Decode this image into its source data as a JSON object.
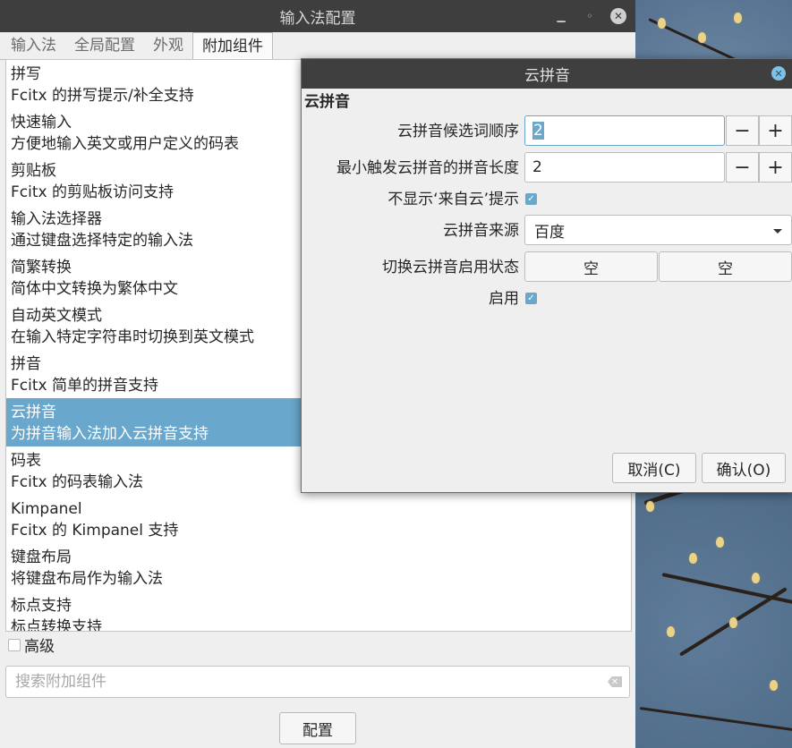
{
  "main_window": {
    "title": "输入法配置",
    "tabs": [
      {
        "label": "输入法"
      },
      {
        "label": "全局配置"
      },
      {
        "label": "外观"
      },
      {
        "label": "附加组件"
      }
    ],
    "addons": [
      {
        "name": "拼写",
        "desc": "Fcitx 的拼写提示/补全支持"
      },
      {
        "name": "快速输入",
        "desc": "方便地输入英文或用户定义的码表"
      },
      {
        "name": "剪贴板",
        "desc": "Fcitx 的剪贴板访问支持"
      },
      {
        "name": "输入法选择器",
        "desc": "通过键盘选择特定的输入法"
      },
      {
        "name": "简繁转换",
        "desc": "简体中文转换为繁体中文"
      },
      {
        "name": "自动英文模式",
        "desc": "在输入特定字符串时切换到英文模式"
      },
      {
        "name": "拼音",
        "desc": "Fcitx 简单的拼音支持"
      },
      {
        "name": "云拼音",
        "desc": "为拼音输入法加入云拼音支持"
      },
      {
        "name": "码表",
        "desc": "Fcitx 的码表输入法"
      },
      {
        "name": "Kimpanel",
        "desc": "Fcitx 的 Kimpanel 支持"
      },
      {
        "name": "键盘布局",
        "desc": "将键盘布局作为输入法"
      },
      {
        "name": "标点支持",
        "desc": "标点转换支持"
      }
    ],
    "advanced_label": "高级",
    "search_placeholder": "搜索附加组件",
    "config_button": "配置"
  },
  "dialog": {
    "title": "云拼音",
    "section": "云拼音",
    "fields": {
      "candidate_order_label": "云拼音候选词顺序",
      "candidate_order_value": "2",
      "min_length_label": "最小触发云拼音的拼音长度",
      "min_length_value": "2",
      "hide_hint_label": "不显示‘来自云’提示",
      "source_label": "云拼音来源",
      "source_value": "百度",
      "toggle_label": "切换云拼音启用状态",
      "toggle_key1": "空",
      "toggle_key2": "空",
      "enable_label": "启用"
    },
    "minus": "−",
    "plus": "+",
    "cancel_button": "取消(C)",
    "ok_button": "确认(O)"
  }
}
